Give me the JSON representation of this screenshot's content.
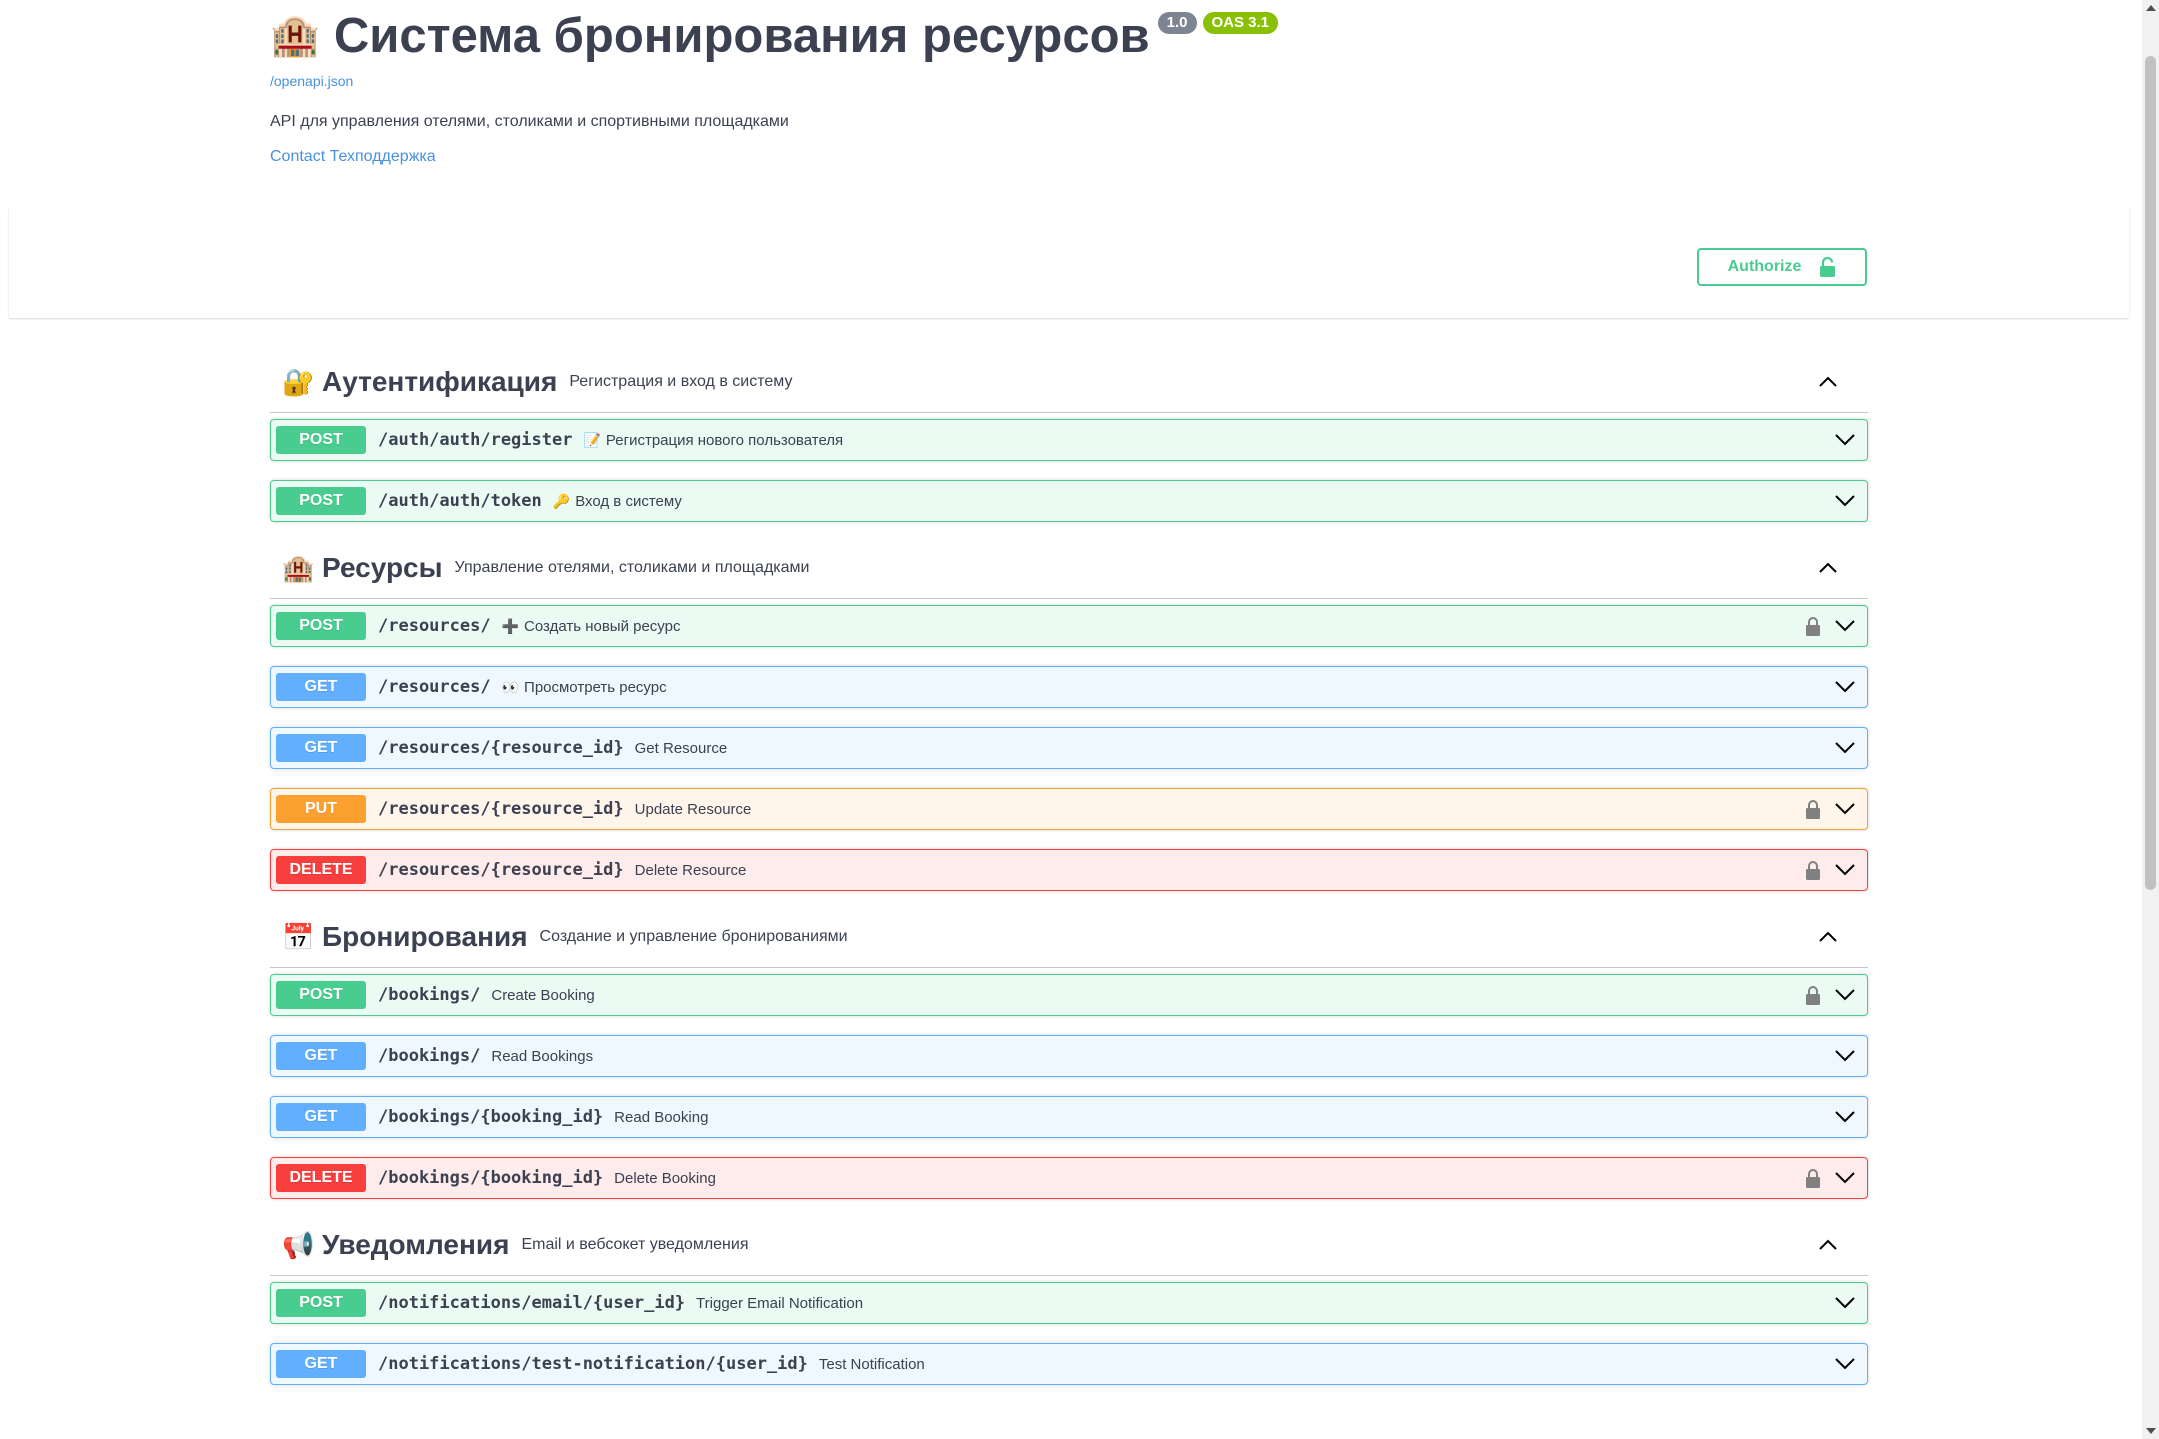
{
  "info": {
    "title_emoji": "🏨",
    "title": "Система бронирования ресурсов",
    "version": "1.0",
    "oas": "OAS 3.1",
    "spec_link": "/openapi.json",
    "description": "API для управления отелями, столиками и спортивными площадками",
    "contact": "Contact Техподдержка"
  },
  "authorize": {
    "label": "Authorize"
  },
  "colors": {
    "post": "#49cc90",
    "get": "#61affe",
    "put": "#fca130",
    "delete": "#f93e3e",
    "link": "#4990e2"
  },
  "tags": [
    {
      "emoji": "🔐",
      "name": "Аутентификация",
      "description": "Регистрация и вход в систему",
      "operations": [
        {
          "method": "POST",
          "path": "/auth/auth/register",
          "summary_icon": "📝",
          "summary": "Регистрация нового пользователя",
          "locked": false
        },
        {
          "method": "POST",
          "path": "/auth/auth/token",
          "summary_icon": "🔑",
          "summary": "Вход в систему",
          "locked": false
        }
      ]
    },
    {
      "emoji": "🏨",
      "name": "Ресурсы",
      "description": "Управление отелями, столиками и площадками",
      "operations": [
        {
          "method": "POST",
          "path": "/resources/",
          "summary_icon": "➕",
          "summary": "Создать новый ресурс",
          "locked": true
        },
        {
          "method": "GET",
          "path": "/resources/",
          "summary_icon": "👀",
          "summary": "Просмотреть ресурс",
          "locked": false
        },
        {
          "method": "GET",
          "path": "/resources/{resource_id}",
          "summary_icon": "",
          "summary": "Get Resource",
          "locked": false
        },
        {
          "method": "PUT",
          "path": "/resources/{resource_id}",
          "summary_icon": "",
          "summary": "Update Resource",
          "locked": true
        },
        {
          "method": "DELETE",
          "path": "/resources/{resource_id}",
          "summary_icon": "",
          "summary": "Delete Resource",
          "locked": true
        }
      ]
    },
    {
      "emoji": "📅",
      "name": "Бронирования",
      "description": "Создание и управление бронированиями",
      "operations": [
        {
          "method": "POST",
          "path": "/bookings/",
          "summary_icon": "",
          "summary": "Create Booking",
          "locked": true
        },
        {
          "method": "GET",
          "path": "/bookings/",
          "summary_icon": "",
          "summary": "Read Bookings",
          "locked": false
        },
        {
          "method": "GET",
          "path": "/bookings/{booking_id}",
          "summary_icon": "",
          "summary": "Read Booking",
          "locked": false
        },
        {
          "method": "DELETE",
          "path": "/bookings/{booking_id}",
          "summary_icon": "",
          "summary": "Delete Booking",
          "locked": true
        }
      ]
    },
    {
      "emoji": "📢",
      "name": "Уведомления",
      "description": "Email и вебсокет уведомления",
      "operations": [
        {
          "method": "POST",
          "path": "/notifications/email/{user_id}",
          "summary_icon": "",
          "summary": "Trigger Email Notification",
          "locked": false
        },
        {
          "method": "GET",
          "path": "/notifications/test-notification/{user_id}",
          "summary_icon": "",
          "summary": "Test Notification",
          "locked": false
        }
      ]
    }
  ]
}
